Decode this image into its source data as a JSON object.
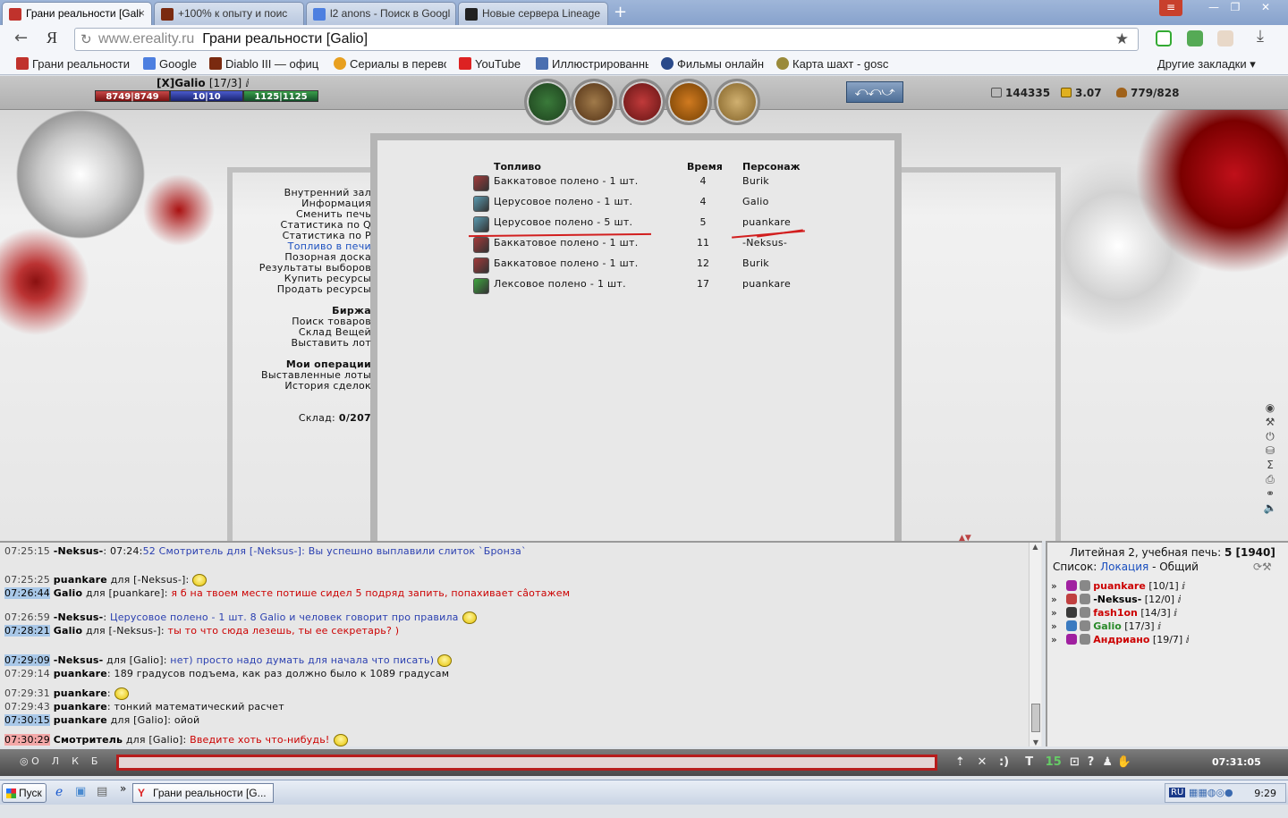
{
  "browser": {
    "tabs": [
      {
        "label": "Грани реальности [Gali",
        "active": true
      },
      {
        "label": "+100% к опыту и поис",
        "active": false
      },
      {
        "label": "l2 anons - Поиск в Googl",
        "active": false
      },
      {
        "label": "Новые сервера Lineage",
        "active": false
      }
    ],
    "url_domain": "www.ereality.ru",
    "url_title": "Грани реальности [Galio]",
    "bookmarks": [
      "Грани реальности",
      "Google",
      "Diablo III — офиц",
      "Сериалы в перево",
      "YouTube",
      "Иллюстрированнь",
      "Фильмы онлайн",
      "Карта шахт - gosc"
    ],
    "other_bookmarks": "Другие закладки ▾"
  },
  "game": {
    "char_name": "[X]Galio",
    "char_level": "[17/3]",
    "hp": "8749|8749",
    "mp": "10|10",
    "energy": "1125|1125",
    "silver": "144335",
    "gold": "3.07",
    "weight": "779/828",
    "menu1": [
      "Внутренний зал",
      "Информация",
      "Сменить печь",
      "Статистика по Q",
      "Статистика по P",
      "Топливо в печи",
      "Позорная доска",
      "Результаты выборов",
      "Купить ресурсы",
      "Продать ресурсы"
    ],
    "menu2_title": "Биржа",
    "menu2": [
      "Поиск товаров",
      "Склад Вещей",
      "Выставить лот"
    ],
    "menu3_title": "Мои операции",
    "menu3": [
      "Выставленные лоты",
      "История сделок"
    ],
    "storage_label": "Склад:",
    "storage_value": "0/207",
    "table": {
      "headers": [
        "Топливо",
        "Время",
        "Персонаж"
      ],
      "rows": [
        {
          "fuel": "Баккатовое полено - 1 шт.",
          "time": "4",
          "who": "Burik",
          "color": "#a23a3a"
        },
        {
          "fuel": "Церусовое полено - 1 шт.",
          "time": "4",
          "who": "Galio",
          "color": "#5a9ab0"
        },
        {
          "fuel": "Церусовое полено - 5 шт.",
          "time": "5",
          "who": "puankare",
          "color": "#5a9ab0"
        },
        {
          "fuel": "Баккатовое полено - 1 шт.",
          "time": "11",
          "who": "-Neksus-",
          "color": "#a23a3a"
        },
        {
          "fuel": "Баккатовое полено - 1 шт.",
          "time": "12",
          "who": "Burik",
          "color": "#a23a3a"
        },
        {
          "fuel": "Лексовое полено - 1 шт.",
          "time": "17",
          "who": "puankare",
          "color": "#3fa53f"
        }
      ]
    }
  },
  "chat": [
    {
      "ts": "07:25:15",
      "tsStyle": "",
      "nick": "-Neksus-",
      "mid": ": 07:24:",
      "text": "52 Смотритель для [-Neksus-]: Вы успешно выплавили слиток `Бронза`",
      "tc": "blue"
    },
    {
      "ts": "07:25:25",
      "tsStyle": "",
      "nick": "puankare",
      "mid": " для [-Neksus-]:",
      "text": "",
      "tc": ""
    },
    {
      "ts": "07:26:44",
      "tsStyle": "hl",
      "nick": "Galio",
      "mid": " для [puankare]:",
      "text": " я б на твоем месте потише сидел 5 подряд запить, попахивает сâотажем",
      "tc": "redt"
    },
    {
      "ts": "07:26:59",
      "tsStyle": "",
      "nick": "-Neksus-",
      "mid": ":",
      "text": " Церусовое полено - 1 шт. 8 Galio и человек говорит про правила",
      "tc": "blue"
    },
    {
      "ts": "07:28:21",
      "tsStyle": "hl",
      "nick": "Galio",
      "mid": " для [-Neksus-]:",
      "text": " ты то что сюда лезешь, ты ее секретарь? )",
      "tc": "redt"
    },
    {
      "ts": "07:29:09",
      "tsStyle": "hl",
      "nick": "-Neksus-",
      "mid": " для [Galio]:",
      "text": " нет) просто надо думать для начала что писать)",
      "tc": "blue"
    },
    {
      "ts": "07:29:14",
      "tsStyle": "",
      "nick": "puankare",
      "mid": ":",
      "text": " 189 градусов подъема, как раз должно было к 1089 градусам",
      "tc": ""
    },
    {
      "ts": "07:29:31",
      "tsStyle": "",
      "nick": "puankare",
      "mid": ":",
      "text": "",
      "tc": ""
    },
    {
      "ts": "07:29:43",
      "tsStyle": "",
      "nick": "puankare",
      "mid": ":",
      "text": " тонкий математический расчет",
      "tc": ""
    },
    {
      "ts": "07:30:15",
      "tsStyle": "hl",
      "nick": "puankare",
      "mid": " для [Galio]:",
      "text": " ойой",
      "tc": ""
    },
    {
      "ts": "07:30:29",
      "tsStyle": "red",
      "nick": "Смотритель",
      "mid": " для [Galio]:",
      "text": " Введите хоть что-нибудь!",
      "tc": "redt"
    }
  ],
  "right": {
    "loc_text": "Литейная 2, учебная печь:",
    "loc_num": "5 [1940]",
    "list_label": "Список:",
    "list_loc": "Локация",
    "list_common": "- Общий",
    "players": [
      {
        "name": "puankare",
        "lvl": "[10/1]",
        "color": "#c00"
      },
      {
        "name": "-Neksus-",
        "lvl": "[12/0]",
        "color": "#000"
      },
      {
        "name": "fash1on",
        "lvl": "[14/3]",
        "color": "#c00"
      },
      {
        "name": "Galio",
        "lvl": "[17/3]",
        "color": "#2a8a2a"
      },
      {
        "name": "Андриано",
        "lvl": "[19/7]",
        "color": "#c00"
      }
    ]
  },
  "chatbar": {
    "buttons": [
      "О",
      "Л",
      "К",
      "Б"
    ],
    "clock": "07:31:05",
    "number": "15"
  },
  "taskbar": {
    "start": "Пуск",
    "task": "Грани реальности [G...",
    "lang": "RU",
    "time": "9:29"
  }
}
